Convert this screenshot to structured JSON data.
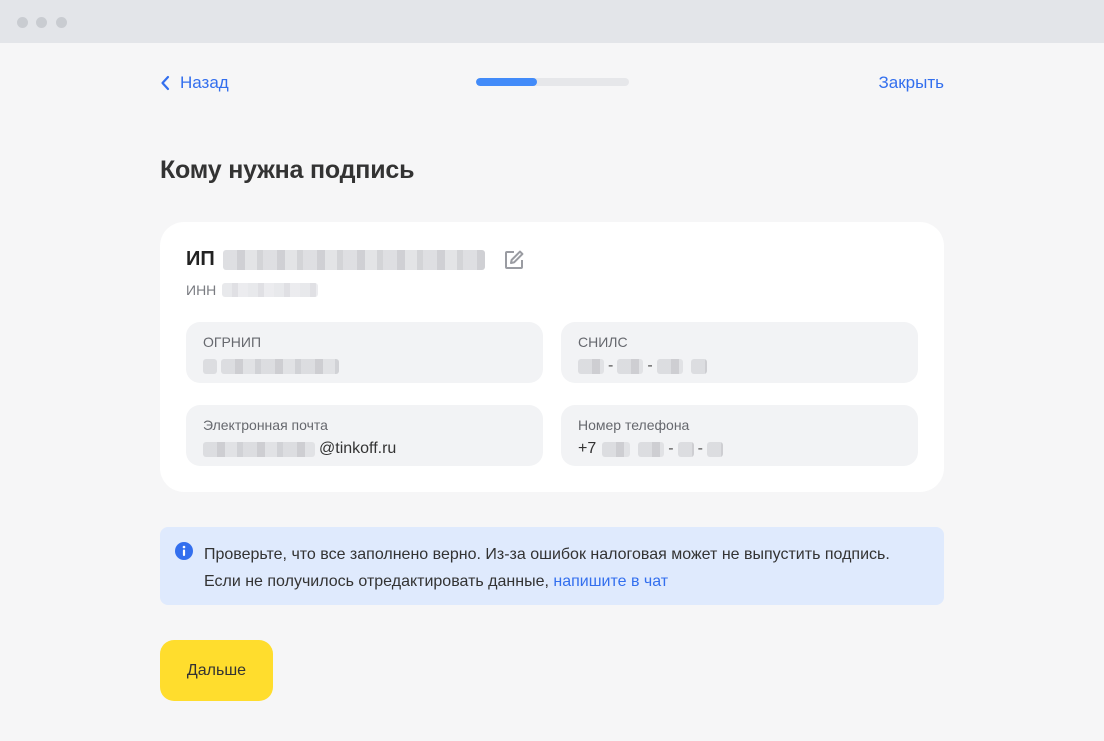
{
  "nav": {
    "back_label": "Назад",
    "close_label": "Закрыть",
    "progress_fraction": 0.4
  },
  "page": {
    "title": "Кому нужна подпись"
  },
  "card": {
    "entity_type": "ИП",
    "inn_label": "ИНН",
    "fields": {
      "ogrnip": {
        "label": "ОГРНИП"
      },
      "snils": {
        "label": "СНИЛС",
        "separator": "-"
      },
      "email": {
        "label": "Электронная почта",
        "domain": "@tinkoff.ru"
      },
      "phone": {
        "label": "Номер телефона",
        "prefix": "+7",
        "separator": "-"
      }
    }
  },
  "notice": {
    "text": "Проверьте, что все заполнено верно. Из-за ошибок налоговая может не выпустить подпись. Если не получилось отредактировать данные, ",
    "link_label": "напишите в чат"
  },
  "actions": {
    "next_label": "Дальше"
  },
  "colors": {
    "accent_blue": "#336fee",
    "progress_blue": "#428bf9",
    "primary_yellow": "#ffdd2d",
    "notice_bg": "#dfeafd"
  }
}
